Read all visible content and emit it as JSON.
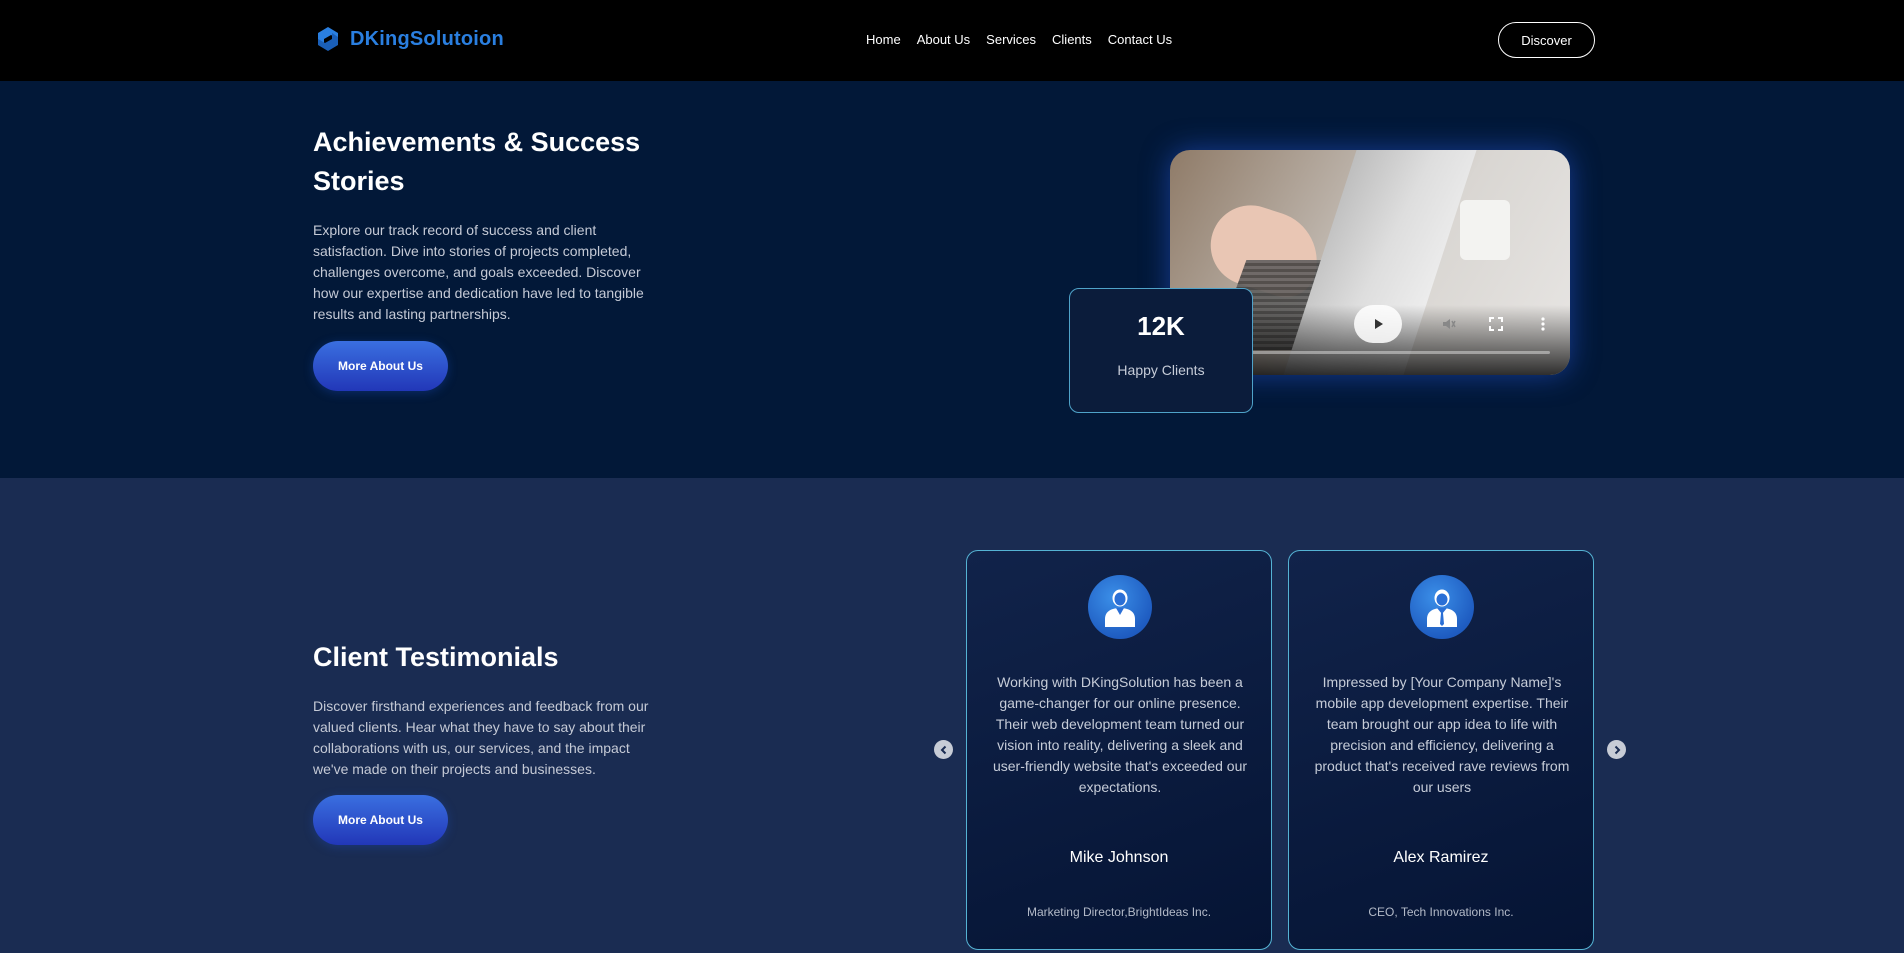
{
  "header": {
    "brand": "DKingSolutoion",
    "nav": [
      "Home",
      "About Us",
      "Services",
      "Clients",
      "Contact Us"
    ],
    "discover_label": "Discover"
  },
  "hero": {
    "title": "Achievements & Success Stories",
    "description": "Explore our track record of success and client satisfaction. Dive into stories of projects completed, challenges overcome, and goals exceeded. Discover how our expertise and dedication have led to tangible results and lasting partnerships.",
    "button_label": "More About Us",
    "stat": {
      "value": "12K",
      "label": "Happy Clients"
    }
  },
  "testimonials": {
    "title": "Client Testimonials",
    "description": "Discover firsthand experiences and feedback from our valued clients. Hear what they have to say about their collaborations with us, our services, and the impact we've made on their projects and businesses.",
    "button_label": "More About Us",
    "cards": [
      {
        "quote": "Working with DKingSolution has been a game-changer for our online presence. Their web development team turned our vision into reality, delivering a sleek and user-friendly website that's exceeded our expectations.",
        "name": "Mike Johnson",
        "role": "Marketing Director,BrightIdeas Inc.",
        "avatar_icon": "male-user-icon"
      },
      {
        "quote": "Impressed by [Your Company Name]'s mobile app development expertise. Their team brought our app idea to life with precision and efficiency, delivering a product that's received rave reviews from our users",
        "name": "Alex Ramirez",
        "role": "CEO, Tech Innovations Inc.",
        "avatar_icon": "businessman-user-icon"
      }
    ]
  },
  "colors": {
    "header_bg": "#000000",
    "hero_bg": "#021838",
    "section_bg": "#1a2c52",
    "brand_blue": "#2a7fe0",
    "card_border": "#55b3d4"
  }
}
